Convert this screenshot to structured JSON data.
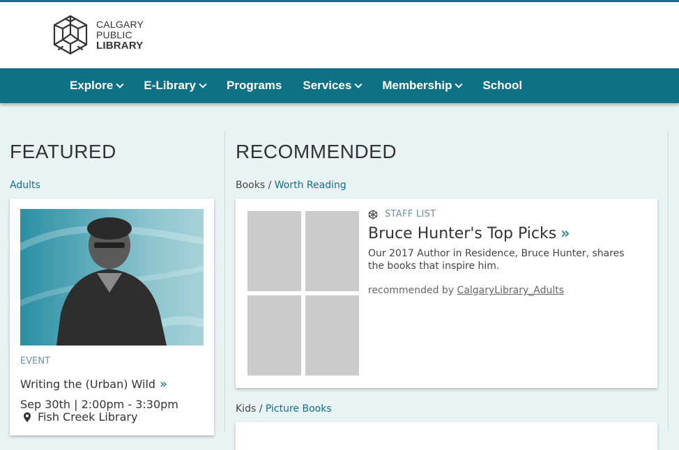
{
  "logo": {
    "line1": "CALGARY",
    "line2": "PUBLIC",
    "line3": "LIBRARY",
    "icon": "snowflake-hex-icon"
  },
  "nav": {
    "items": [
      {
        "label": "Explore",
        "dropdown": true
      },
      {
        "label": "E-Library",
        "dropdown": true
      },
      {
        "label": "Programs",
        "dropdown": false
      },
      {
        "label": "Services",
        "dropdown": true
      },
      {
        "label": "Membership",
        "dropdown": true
      },
      {
        "label": "School",
        "dropdown": false
      }
    ]
  },
  "featured": {
    "heading": "FEATURED",
    "category": "Adults",
    "card": {
      "kicker": "EVENT",
      "title": "Writing the (Urban) Wild",
      "arrow": "»",
      "datetime": "Sep 30th | 2:00pm - 3:30pm",
      "location": "Fish Creek Library"
    }
  },
  "recommended": {
    "heading": "RECOMMENDED",
    "crumb1": {
      "parent": "Books",
      "sep": " / ",
      "child": "Worth Reading"
    },
    "card": {
      "kicker": "STAFF LIST",
      "title": "Bruce Hunter's Top Picks",
      "arrow": "»",
      "description": "Our 2017 Author in Residence, Bruce Hunter, shares the books that inspire him.",
      "by_label": "recommended by ",
      "by_user": "CalgaryLibrary_Adults"
    },
    "crumb2": {
      "parent": "Kids",
      "sep": " / ",
      "child": "Picture Books"
    }
  },
  "colors": {
    "brand": "#0f7185",
    "link": "#0f6e8a",
    "background": "#e9f3f3"
  }
}
